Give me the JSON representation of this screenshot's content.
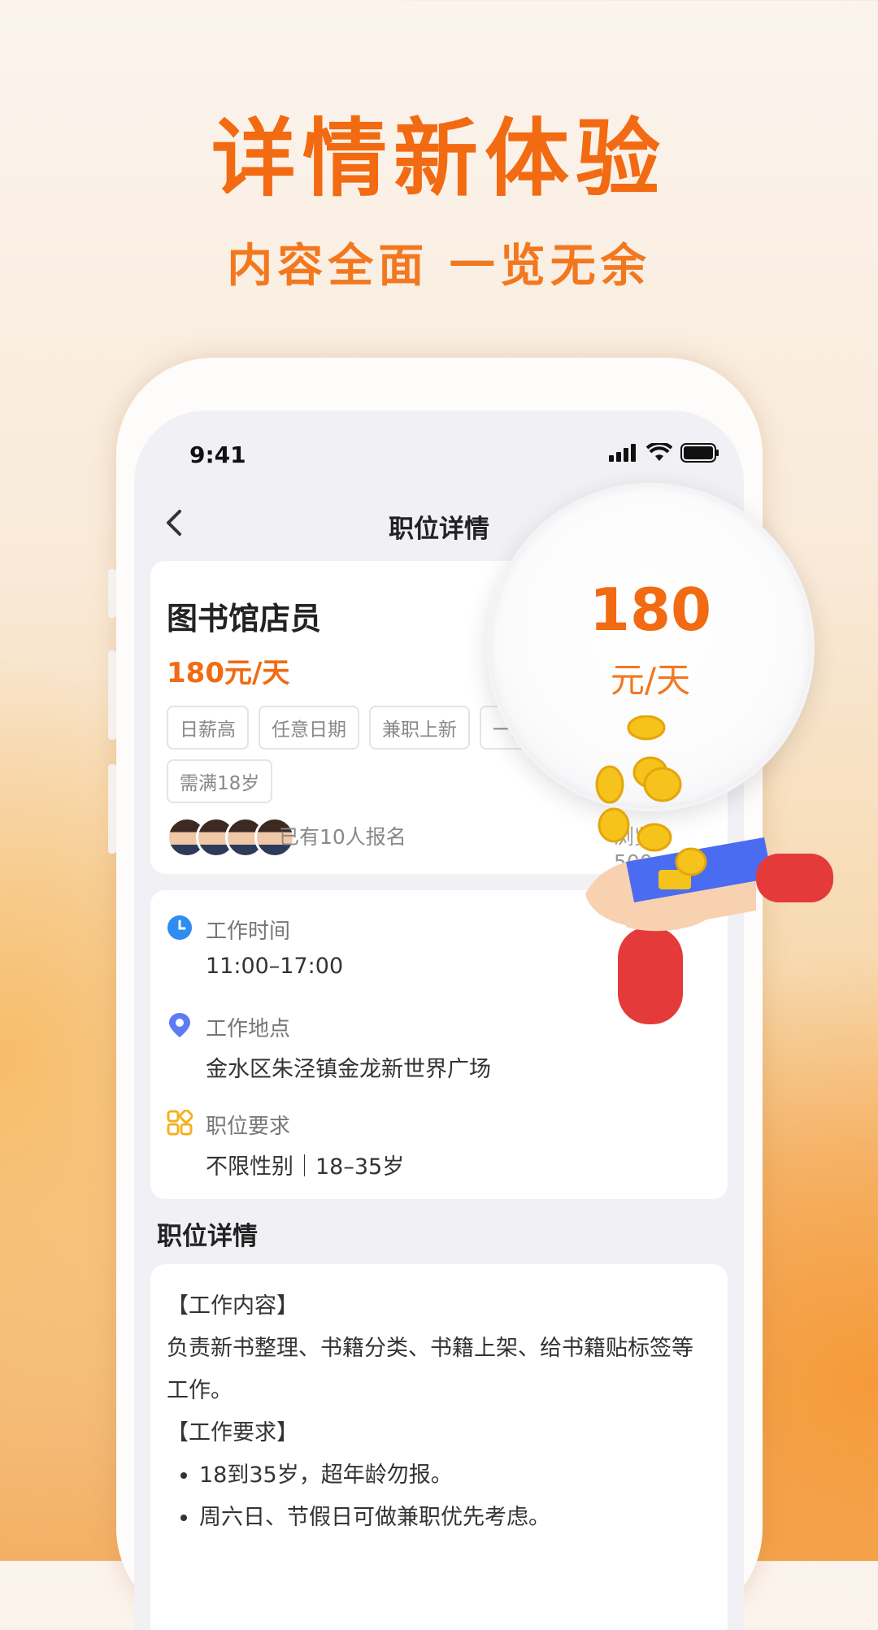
{
  "promo": {
    "headline": "详情新体验",
    "subline": "内容全面 一览无余"
  },
  "status_bar": {
    "time": "9:41",
    "icons": [
      "signal-icon",
      "wifi-icon",
      "battery-icon"
    ]
  },
  "nav": {
    "back_icon": "chevron-left-icon",
    "title": "职位详情"
  },
  "job": {
    "title": "图书馆店员",
    "pay": "180元/天",
    "tags": [
      "日薪高",
      "任意日期",
      "兼职上新",
      "一天一结",
      "需满18岁"
    ],
    "signup": "已有10人报名",
    "views": "浏览：500+"
  },
  "magnifier": {
    "amount": "180",
    "unit": "元/天"
  },
  "info": {
    "work_time": {
      "label": "工作时间",
      "value": "11:00–17:00",
      "icon": "clock-icon"
    },
    "work_place": {
      "label": "工作地点",
      "value": "金水区朱泾镇金龙新世界广场",
      "icon": "location-pin-icon"
    },
    "requirements": {
      "label": "职位要求",
      "value": "不限性别｜18–35岁",
      "icon": "grid-icon"
    }
  },
  "details": {
    "section_title": "职位详情",
    "content_heading": "【工作内容】",
    "content_text": "负责新书整理、书籍分类、书籍上架、给书籍贴标签等工作。",
    "requirements_heading": "【工作要求】",
    "requirements_items": [
      "18到35岁，超年龄勿报。",
      "周六日、节假日可做兼职优先考虑。"
    ]
  },
  "colors": {
    "accent": "#f26a12",
    "background": "#f1f0f4",
    "card": "#ffffff",
    "clock_blue": "#2f8cf0",
    "pin_blue": "#5b7cf5",
    "grid_yellow": "#f5b020"
  }
}
